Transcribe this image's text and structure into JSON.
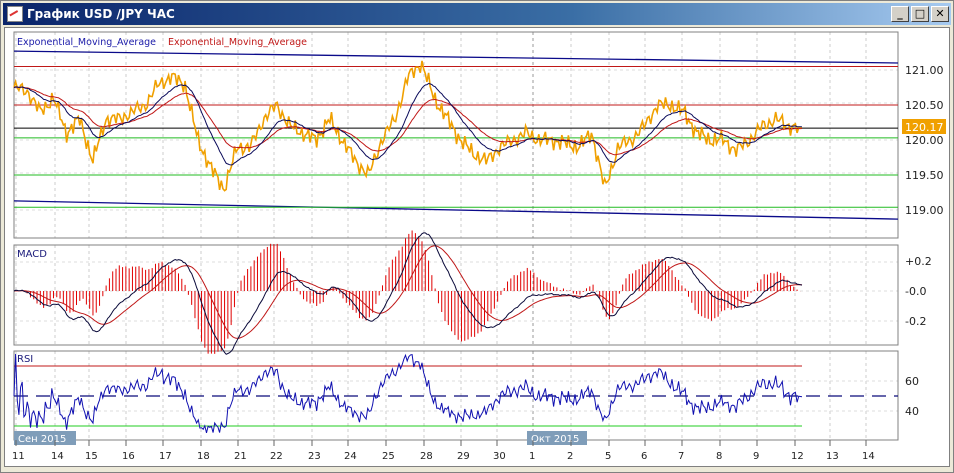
{
  "window": {
    "title": "График USD /JPY  ЧАС",
    "minimize": "_",
    "maximize": "□",
    "close": "✕"
  },
  "legend": {
    "ema_blue": "Exponential_Moving_Average",
    "ema_red": "Exponential_Moving_Average"
  },
  "price_axis": {
    "ticks": [
      "121.00",
      "120.50",
      "120.00",
      "119.50",
      "119.00"
    ],
    "current": "120.17",
    "current_color": "#f0a000"
  },
  "macd": {
    "title": "MACD",
    "ticks": [
      "+0.2",
      "-0.0",
      "-0.2"
    ]
  },
  "rsi": {
    "title": "RSI",
    "ticks": [
      "60",
      "40"
    ]
  },
  "date_axis": {
    "labels": [
      "11",
      "14",
      "15",
      "16",
      "17",
      "18",
      "21",
      "22",
      "23",
      "24",
      "25",
      "28",
      "29",
      "30",
      "1",
      "2",
      "5",
      "6",
      "7",
      "8",
      "9",
      "12",
      "13",
      "14"
    ],
    "month_badges": [
      "Сен 2015",
      "Окт 2015"
    ]
  },
  "chart_data": {
    "type": "line",
    "symbol": "USD/JPY",
    "timeframe": "hour",
    "price": [
      120.75,
      120.7,
      120.4,
      120.6,
      120.1,
      120.3,
      119.7,
      120.3,
      120.3,
      120.4,
      120.5,
      120.8,
      120.9,
      120.8,
      120.0,
      119.6,
      119.3,
      119.9,
      119.9,
      120.3,
      120.5,
      120.2,
      120.1,
      120.0,
      120.3,
      120.0,
      119.7,
      119.5,
      120.0,
      120.3,
      120.9,
      121.1,
      120.6,
      120.3,
      120.0,
      119.8,
      119.7,
      119.9,
      120.0,
      120.1,
      120.0,
      120.0,
      119.95,
      119.9,
      120.1,
      119.3,
      119.9,
      120.0,
      120.2,
      120.5,
      120.5,
      120.4,
      120.1,
      120.0,
      120.0,
      119.85,
      120.0,
      120.2,
      120.3,
      120.2,
      120.17
    ],
    "levels": {
      "red": [
        121.05,
        120.5
      ],
      "black": [
        120.17
      ],
      "green": [
        120.03,
        119.5,
        119.04
      ]
    },
    "channel": {
      "upper": [
        121.27,
        121.1
      ],
      "lower": [
        119.13,
        118.87
      ]
    },
    "ylim": [
      118.8,
      121.3
    ],
    "rsi_levels": [
      70,
      50,
      30
    ]
  }
}
